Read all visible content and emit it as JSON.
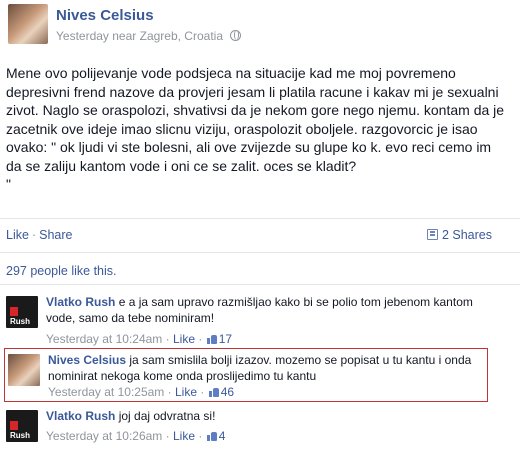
{
  "post": {
    "author": "Nives Celsius",
    "meta": "Yesterday near Zagreb, Croatia",
    "text": "Mene ovo polijevanje vode podsjeca na situacije kad me moj povremeno depresivni frend nazove da provjeri jesam li platila racune i kakav mi je sexualni zivot. Naglo se oraspolozi, shvativsi da je nekom gore nego njemu. kontam da je zacetnik ove ideje imao slicnu viziju, oraspolozit oboljele. razgovorcic je isao ovako: \" ok ljudi vi ste bolesni, ali ove zvijezde su glupe ko k. evo reci cemo im da se zaliju kantom vode i oni ce se zalit. oces se kladit?\n\""
  },
  "actions": {
    "like": "Like",
    "separator": "·",
    "share": "Share",
    "shares": "2 Shares"
  },
  "likes_summary": "297 people like this.",
  "comments": [
    {
      "author": "Vlatko Rush",
      "text": " e a ja sam upravo razmišljao kako bi se polio tom jebenom kantom vode, samo da tebe nominiram!",
      "time": "Yesterday at 10:24am",
      "like": "Like",
      "likes": "17",
      "avatar_logo": "Rush"
    },
    {
      "author": "Nives Celsius",
      "text": " ja sam smislila bolji izazov. mozemo se popisat u tu kantu i onda nominirat nekoga kome onda proslijedimo tu kantu",
      "time": "Yesterday at 10:25am",
      "like": "Like",
      "likes": "46",
      "highlighted": true
    },
    {
      "author": "Vlatko Rush",
      "text": " joj daj odvratna si!",
      "time": "Yesterday at 10:26am",
      "like": "Like",
      "likes": "4",
      "avatar_logo": "Rush"
    }
  ],
  "icons": {
    "globe": "globe-icon",
    "share": "share-icon",
    "thumb": "thumbs-up-icon"
  },
  "colors": {
    "link": "#3b5998",
    "muted": "#90949c",
    "highlight_border": "#c03434"
  }
}
